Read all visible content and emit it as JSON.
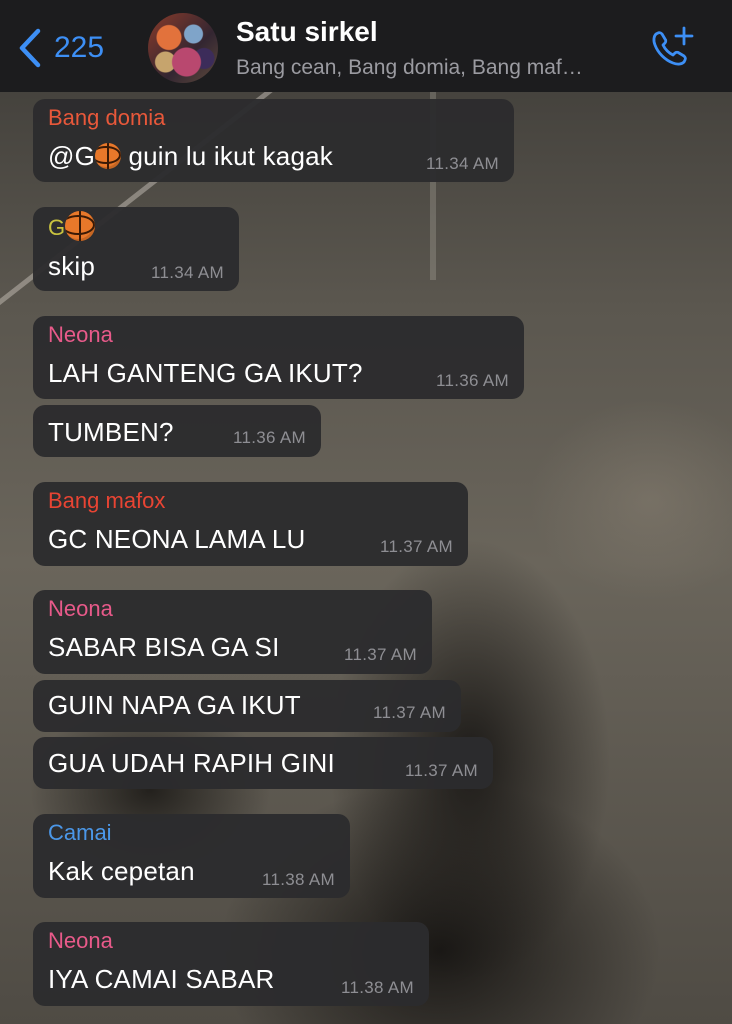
{
  "header": {
    "back_count": "225",
    "title": "Satu sirkel",
    "subtitle": "Bang cean, Bang domia, Bang maf…",
    "icons": {
      "back": "chevron-left-icon",
      "call": "add-call-icon",
      "emoji": "basketball-icon"
    }
  },
  "colors": {
    "accent": "#3d8ff5",
    "bang_domia": "#e8583a",
    "g": "#c9c33f",
    "neona": "#e85a8a",
    "bang_mafox": "#e84433",
    "camai": "#4b97e8",
    "bubble": "#2c2c2e",
    "timestamp": "#8e8e93"
  },
  "messages": [
    {
      "sender": "Bang domia",
      "mention": "@G",
      "text": " guin lu ikut kagak",
      "time": "11.34 AM"
    },
    {
      "sender": "G",
      "text": "skip",
      "time": "11.34 AM"
    },
    {
      "sender": "Neona",
      "text": "LAH GANTENG GA IKUT?",
      "time": "11.36 AM"
    },
    {
      "sender": "",
      "text": "TUMBEN?",
      "time": "11.36 AM"
    },
    {
      "sender": "Bang mafox",
      "text": "GC NEONA LAMA LU",
      "time": "11.37 AM"
    },
    {
      "sender": "Neona",
      "text": "SABAR BISA GA SI",
      "time": "11.37 AM"
    },
    {
      "sender": "",
      "text": "GUIN NAPA GA IKUT",
      "time": "11.37 AM"
    },
    {
      "sender": "",
      "text": "GUA UDAH RAPIH GINI",
      "time": "11.37 AM"
    },
    {
      "sender": "Camai",
      "text": "Kak cepetan",
      "time": "11.38 AM"
    },
    {
      "sender": "Neona",
      "text": "IYA CAMAI SABAR",
      "time": "11.38 AM"
    }
  ]
}
